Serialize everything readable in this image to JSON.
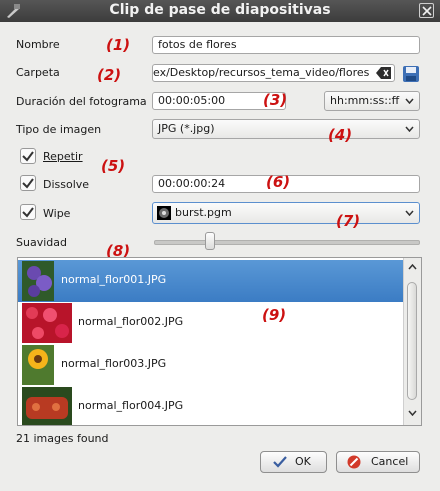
{
  "window": {
    "title": "Clip de pase de diapositivas"
  },
  "form": {
    "nombre_label": "Nombre",
    "nombre_value": "fotos de flores",
    "carpeta_label": "Carpeta",
    "carpeta_value": "ex/Desktop/recursos_tema_video/flores",
    "duracion_label": "Duración del fotograma",
    "duracion_value": "00:00:05:00",
    "time_format": "hh:mm:ss::ff",
    "tipo_label": "Tipo de imagen",
    "tipo_value": "JPG (*.jpg)",
    "repetir_label": "Repetir",
    "repetir_checked": true,
    "dissolve_label": "Dissolve",
    "dissolve_checked": true,
    "dissolve_value": "00:00:00:24",
    "wipe_label": "Wipe",
    "wipe_checked": true,
    "wipe_value": "burst.pgm",
    "suavidad_label": "Suavidad",
    "suavidad_level": 0.2
  },
  "annotations": [
    "(1)",
    "(2)",
    "(3)",
    "(4)",
    "(5)",
    "(6)",
    "(7)",
    "(8)",
    "(9)"
  ],
  "images": [
    {
      "name": "normal_flor001.JPG",
      "selected": true
    },
    {
      "name": "normal_flor002.JPG",
      "selected": false
    },
    {
      "name": "normal_flor003.JPG",
      "selected": false
    },
    {
      "name": "normal_flor004.JPG",
      "selected": false
    }
  ],
  "status": "21 images found",
  "buttons": {
    "ok": "OK",
    "cancel": "Cancel"
  },
  "colors": {
    "title_bg": "#3c3c3c",
    "selection": "#3b7cc4",
    "annotation": "#cc1111"
  }
}
